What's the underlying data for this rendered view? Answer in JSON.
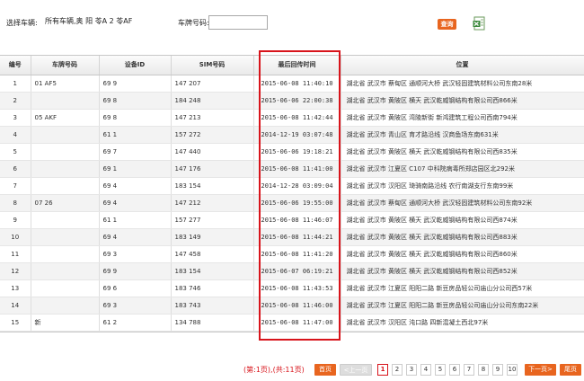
{
  "filters": {
    "vehicle_label": "选择车辆:",
    "vehicle_value": "所有车辆,奥 阳 苓A 2 苓AF",
    "plate_label": "车牌号码:",
    "plate_value": "",
    "query_label": "查询",
    "export_icon": "excel-export-icon"
  },
  "table": {
    "columns": [
      "编号",
      "车牌号码",
      "设备ID",
      "SIM号码",
      "最后回传时间",
      "位置"
    ],
    "rows": [
      {
        "no": "1",
        "plate": "01 AF5",
        "device": "69 9",
        "sim": "147 207",
        "time": "2015-06-08 11:40:10",
        "location": "湖北省 武汉市 蔡甸区 通顺河大桥 武汉轻固建筑材料公司东南28米"
      },
      {
        "no": "2",
        "plate": "",
        "device": "69 8",
        "sim": "184 248",
        "time": "2015-06-06 22:00:38",
        "location": "湖北省 武汉市 黄陂区 横天 武汉乾威钢结构有限公司西866米"
      },
      {
        "no": "3",
        "plate": "05 AKF",
        "device": "69 8",
        "sim": "147 213",
        "time": "2015-06-08 11:42:44",
        "location": "湖北省 武汉市 黄陂区 湾陵新街 新鸿建筑工程公司西南794米"
      },
      {
        "no": "4",
        "plate": "",
        "device": "61 1",
        "sim": "157 272",
        "time": "2014-12-19 03:07:48",
        "location": "湖北省 武汉市 青山区 育才路沿线 汉商鱼场东南631米"
      },
      {
        "no": "5",
        "plate": "",
        "device": "69 7",
        "sim": "147 440",
        "time": "2015-06-06 19:18:21",
        "location": "湖北省 武汉市 黄陂区 横天 武汉乾威钢结构有限公司西835米"
      },
      {
        "no": "6",
        "plate": "",
        "device": "69 1",
        "sim": "147 176",
        "time": "2015-06-08 11:41:00",
        "location": "湖北省 武汉市 江夏区 C107 中科院病毒所郑店园区北292米"
      },
      {
        "no": "7",
        "plate": "",
        "device": "69 4",
        "sim": "183 154",
        "time": "2014-12-28 03:09:04",
        "location": "湖北省 武汉市 汉阳区 琦骑南路沿线 农行南湖支行东南99米"
      },
      {
        "no": "8",
        "plate": "07 26",
        "device": "69 4",
        "sim": "147 212",
        "time": "2015-06-06 19:55:00",
        "location": "湖北省 武汉市 蔡甸区 通顺河大桥 武汉轻固建筑材料公司东南92米"
      },
      {
        "no": "9",
        "plate": "",
        "device": "61 1",
        "sim": "157 277",
        "time": "2015-06-08 11:46:07",
        "location": "湖北省 武汉市 黄陂区 横天 武汉乾威钢结构有限公司西874米"
      },
      {
        "no": "10",
        "plate": "",
        "device": "69 4",
        "sim": "183 149",
        "time": "2015-06-08 11:44:21",
        "location": "湖北省 武汉市 黄陂区 横天 武汉乾威钢结构有限公司西883米"
      },
      {
        "no": "11",
        "plate": "",
        "device": "69 3",
        "sim": "147 458",
        "time": "2015-06-08 11:41:20",
        "location": "湖北省 武汉市 黄陂区 横天 武汉乾威钢结构有限公司西860米"
      },
      {
        "no": "12",
        "plate": "",
        "device": "69 9",
        "sim": "183 154",
        "time": "2015-06-07 06:19:21",
        "location": "湖北省 武汉市 黄陂区 横天 武汉乾威钢结构有限公司西852米"
      },
      {
        "no": "13",
        "plate": "",
        "device": "69 6",
        "sim": "183 746",
        "time": "2015-06-08 11:43:53",
        "location": "湖北省 武汉市 江夏区 阳阳二路 新豆房品轻公司庙山分公司西57米"
      },
      {
        "no": "14",
        "plate": "",
        "device": "69 3",
        "sim": "183 743",
        "time": "2015-06-08 11:46:00",
        "location": "湖北省 武汉市 江夏区 阳阳二路 新豆房品轻公司庙山分公司东南22米"
      },
      {
        "no": "15",
        "plate": "新",
        "device": "61 2",
        "sim": "134 788",
        "time": "2015-06-08 11:47:00",
        "location": "湖北省 武汉市 汉阳区 沌口路 四新混凝土西北97米"
      }
    ]
  },
  "pagination": {
    "info": "(第:1页),(共:11页)",
    "first": "首页",
    "prev": "<上一页",
    "pages": [
      "1",
      "2",
      "3",
      "4",
      "5",
      "6",
      "7",
      "8",
      "9",
      "10"
    ],
    "current": "1",
    "next": "下一页>",
    "last": "尾页"
  },
  "colors": {
    "accent": "#e8651f",
    "highlight": "#d8141b"
  }
}
